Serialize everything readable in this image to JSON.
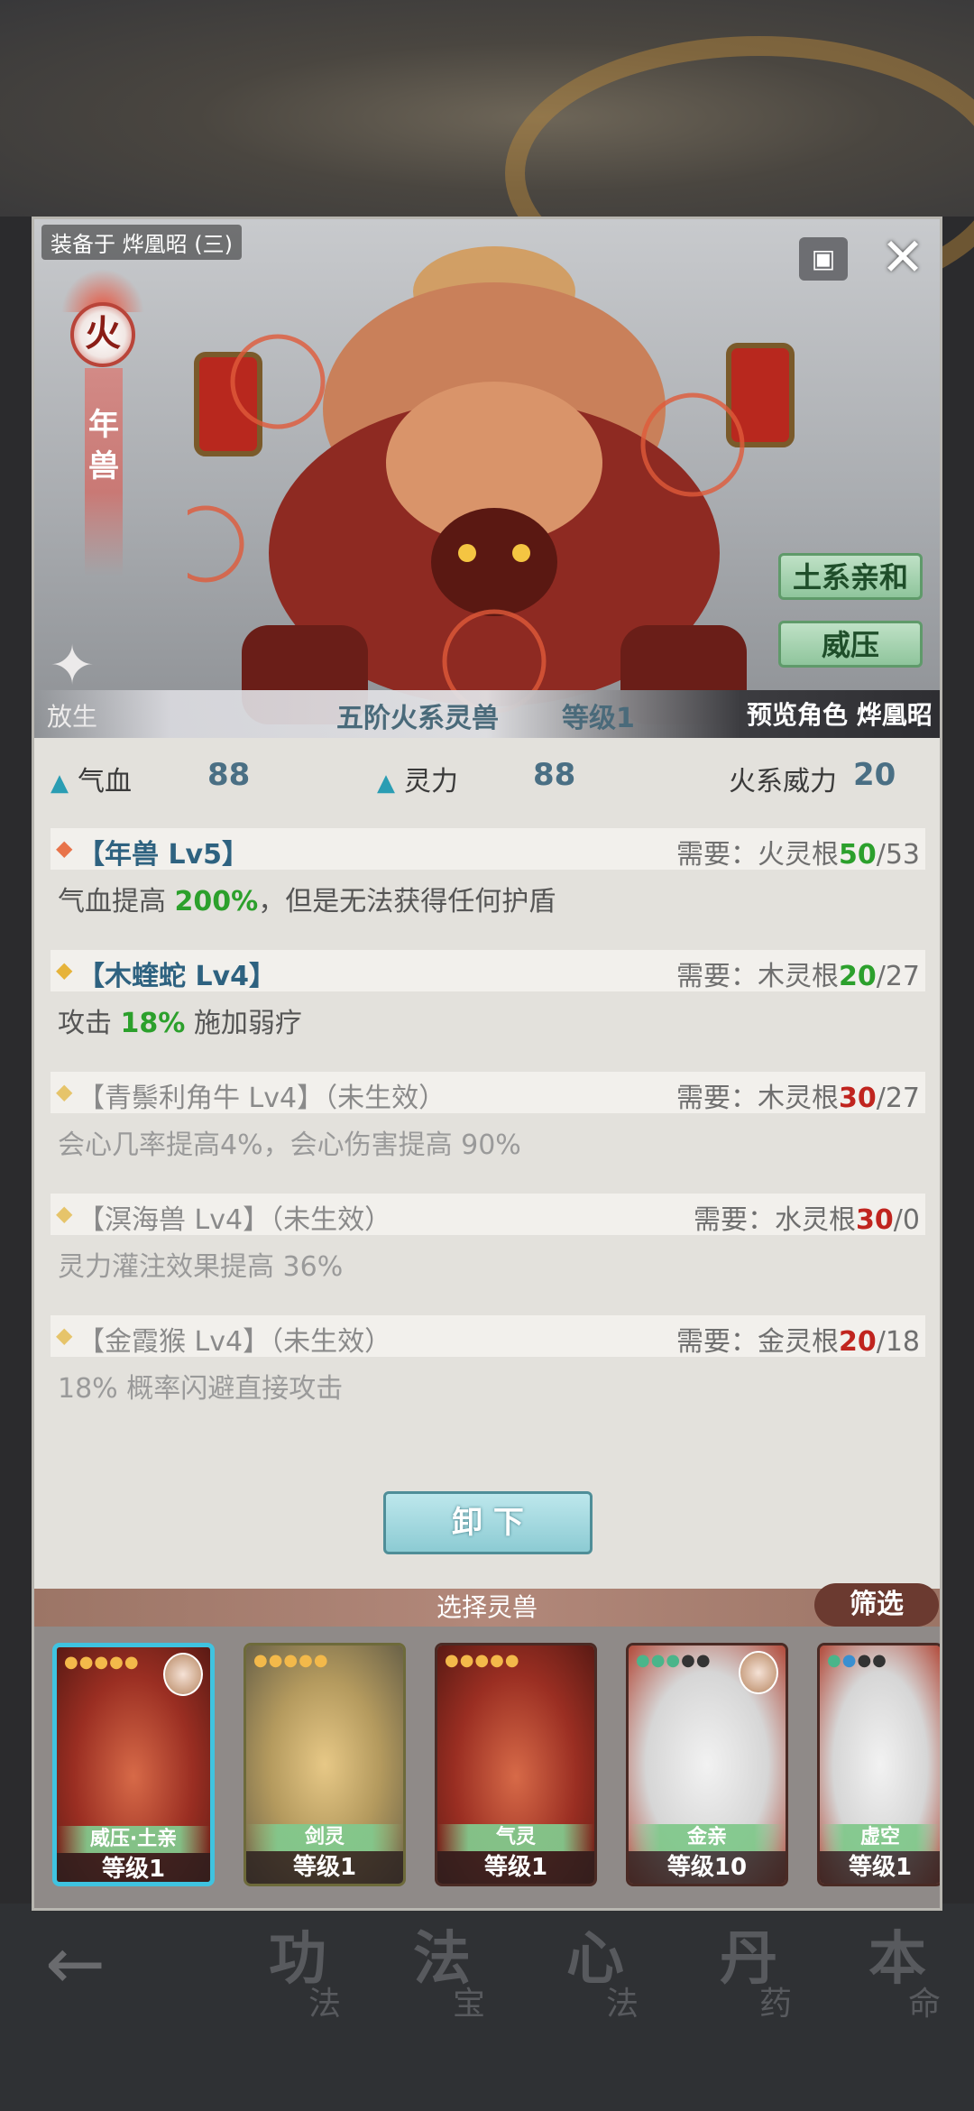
{
  "header": {
    "equipped_on": "装备于 烨凰昭 (三)",
    "element_badge": "火",
    "beast_name": "年\n兽",
    "release_label": "放生",
    "close_icon": "close-icon",
    "corner_icon": "box-icon"
  },
  "traits": [
    "土系亲和",
    "威压"
  ],
  "info_bar": {
    "tier": "五阶火系灵兽",
    "level": "等级1",
    "preview": "预览角色 烨凰昭"
  },
  "stats": {
    "hp_label": "气血",
    "hp_value": "88",
    "sp_label": "灵力",
    "sp_value": "88",
    "power_label": "火系威力",
    "power_value": "20"
  },
  "skills": [
    {
      "title": "【年兽 Lv5】",
      "status": "",
      "req_label": "需要：",
      "req_root": "火灵根",
      "req_have": "50",
      "req_need": "/53",
      "desc_pre": "气血提高 ",
      "desc_num": "200%",
      "desc_post": "，但是无法获得任何护盾",
      "diamond_color": "#e8734a"
    },
    {
      "title": "【木蝰蛇 Lv4】",
      "status": "",
      "req_label": "需要：",
      "req_root": "木灵根",
      "req_have": "20",
      "req_need": "/27",
      "desc_pre": "攻击 ",
      "desc_num": "18%",
      "desc_post": " 施加弱疗",
      "diamond_color": "#e6b33a"
    },
    {
      "title": "【青鬃利角牛 Lv4】",
      "status": "（未生效）",
      "req_label": "需要：",
      "req_root": "木灵根",
      "req_have": "30",
      "req_need": "/27",
      "desc_pre": "会心几率提高4%，会心伤害提高 90%",
      "desc_num": "",
      "desc_post": "",
      "diamond_color": "#e6c46a"
    },
    {
      "title": "【溟海兽 Lv4】",
      "status": "（未生效）",
      "req_label": "需要：",
      "req_root": "水灵根",
      "req_have": "30",
      "req_need": "/0",
      "desc_pre": "灵力灌注效果提高 36%",
      "desc_num": "",
      "desc_post": "",
      "diamond_color": "#e6c46a"
    },
    {
      "title": "【金霞猴 Lv4】",
      "status": "（未生效）",
      "req_label": "需要：",
      "req_root": "金灵根",
      "req_have": "20",
      "req_need": "/18",
      "desc_pre": "18% 概率闪避直接攻击",
      "desc_num": "",
      "desc_post": "",
      "diamond_color": "#e6c46a"
    }
  ],
  "unequip_label": "卸 下",
  "select_title": "选择灵兽",
  "filter_label": "筛选",
  "cards": [
    {
      "name": "威压·土亲",
      "level": "等级1"
    },
    {
      "name": "剑灵",
      "level": "等级1"
    },
    {
      "name": "气灵",
      "level": "等级1"
    },
    {
      "name": "金亲",
      "level": "等级10"
    },
    {
      "name": "虚空",
      "level": "等级1"
    }
  ],
  "background_nav": [
    {
      "big": "功",
      "small": "法"
    },
    {
      "big": "法",
      "small": "宝"
    },
    {
      "big": "心",
      "small": "法"
    },
    {
      "big": "丹",
      "small": "药"
    },
    {
      "big": "本",
      "small": "命"
    }
  ],
  "colors": {
    "accent_teal": "#2a9db3",
    "green_value": "#2ca02c",
    "red_value": "#c0241e",
    "trait_green": "#8fc59c",
    "filter_brown": "#6b3a30"
  }
}
